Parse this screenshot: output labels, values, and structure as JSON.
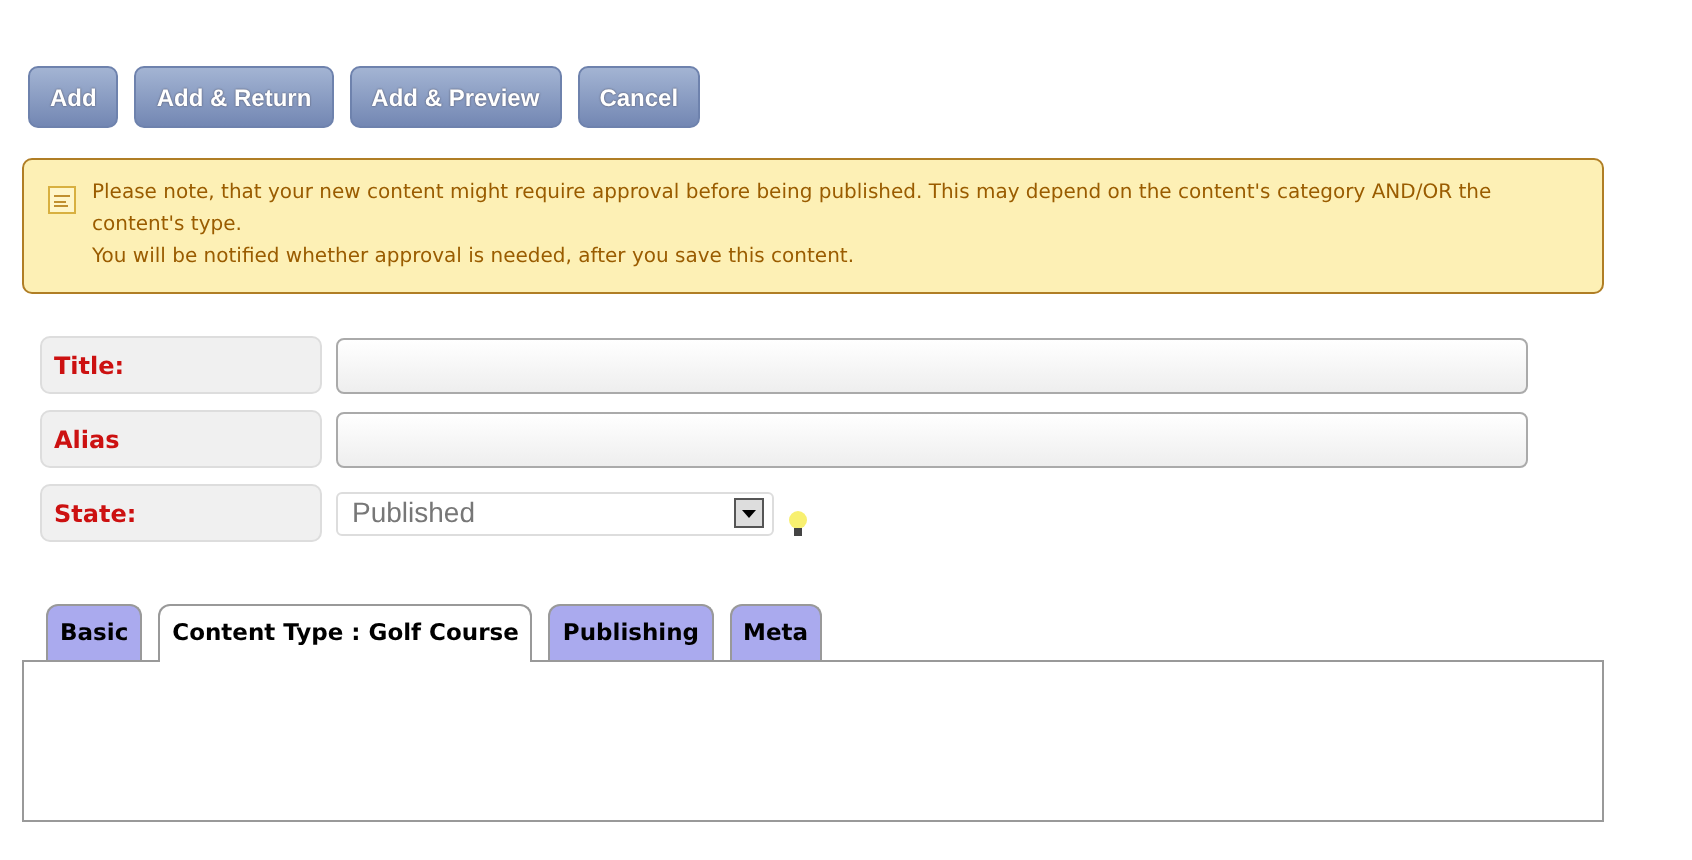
{
  "buttons": [
    "Add",
    "Add & Return",
    "Add & Preview",
    "Cancel"
  ],
  "notice": {
    "lines": [
      "Please note, that your new content might require approval before being published. This may depend on the content's category AND/OR the content's type.",
      "You will be notified whether approval is needed, after you save this content."
    ]
  },
  "fields": [
    {
      "kind": "text",
      "label": "Title:"
    },
    {
      "kind": "text",
      "label": "Alias"
    },
    {
      "kind": "select",
      "label": "State:",
      "value": "Published"
    }
  ],
  "tabs": [
    {
      "label": "Basic",
      "selected": false
    },
    {
      "label": "Content Type : Golf Course",
      "selected": true
    },
    {
      "label": "Publishing",
      "selected": false
    },
    {
      "label": "Meta",
      "selected": false
    }
  ]
}
